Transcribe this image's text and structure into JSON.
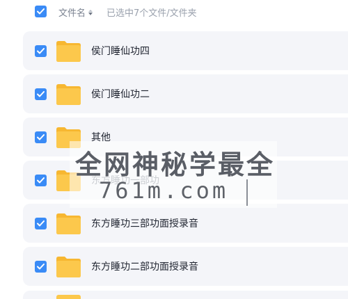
{
  "header": {
    "select_all_checked": true,
    "column_name_label": "文件名",
    "selection_info": "已选中7个文件/文件夹"
  },
  "files": [
    {
      "name": "侯门睡仙功四",
      "checked": true,
      "type": "folder"
    },
    {
      "name": "侯门睡仙功二",
      "checked": true,
      "type": "folder"
    },
    {
      "name": "其他",
      "checked": true,
      "type": "folder"
    },
    {
      "name": "东方睡功一部功",
      "checked": true,
      "type": "folder"
    },
    {
      "name": "东方睡功三部功面授录音",
      "checked": true,
      "type": "folder"
    },
    {
      "name": "东方睡功二部功面授录音",
      "checked": true,
      "type": "folder"
    }
  ],
  "watermark": {
    "line1": "全网神秘学最全",
    "line2": "761m.com"
  },
  "colors": {
    "checkbox": "#3a8bf6",
    "folder": "#fcc84c",
    "row_background": "#f4f5f9"
  },
  "icons": {
    "checkbox": "checkmark-icon",
    "folder": "folder-icon",
    "sort": "sort-icon"
  }
}
